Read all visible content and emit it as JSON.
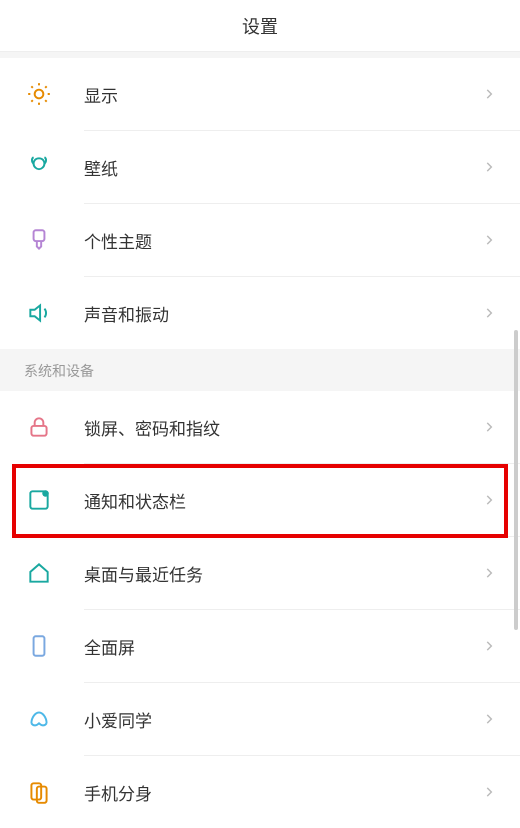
{
  "header": {
    "title": "设置"
  },
  "group1": {
    "items": [
      {
        "label": "显示",
        "icon": "sun-icon",
        "color": "#e68a00"
      },
      {
        "label": "壁纸",
        "icon": "flower-icon",
        "color": "#19a8a0"
      },
      {
        "label": "个性主题",
        "icon": "brush-icon",
        "color": "#b585d4"
      },
      {
        "label": "声音和振动",
        "icon": "sound-icon",
        "color": "#19a8a0"
      }
    ]
  },
  "group2": {
    "label": "系统和设备",
    "items": [
      {
        "label": "锁屏、密码和指纹",
        "icon": "lock-icon",
        "color": "#e57588"
      },
      {
        "label": "通知和状态栏",
        "icon": "notification-icon",
        "color": "#19a8a0"
      },
      {
        "label": "桌面与最近任务",
        "icon": "home-icon",
        "color": "#19a8a0"
      },
      {
        "label": "全面屏",
        "icon": "fullscreen-icon",
        "color": "#7aa8e0"
      },
      {
        "label": "小爱同学",
        "icon": "xiaoai-icon",
        "color": "#4db8e8"
      },
      {
        "label": "手机分身",
        "icon": "clone-icon",
        "color": "#e68a00"
      }
    ]
  }
}
